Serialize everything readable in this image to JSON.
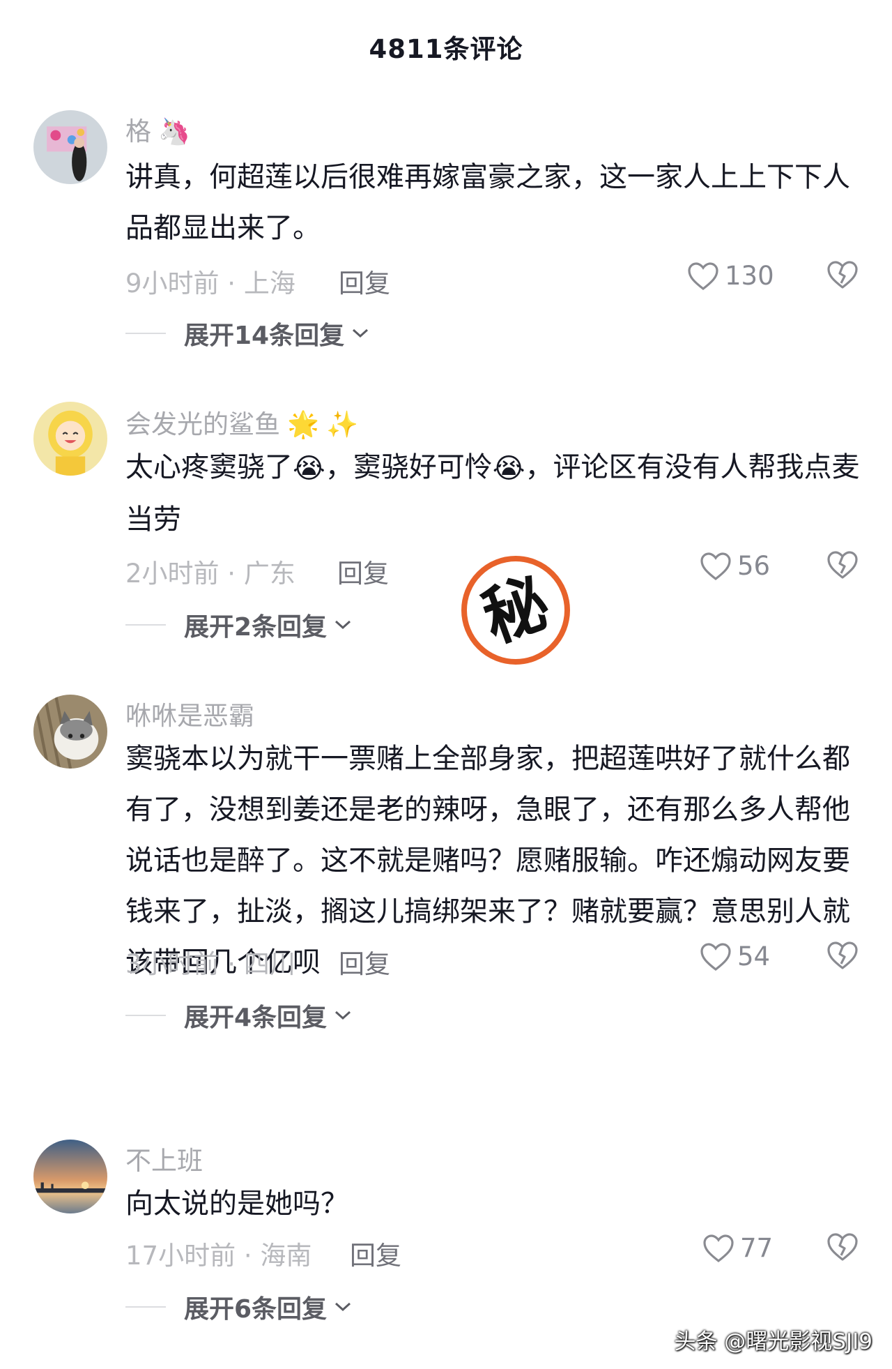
{
  "header": {
    "title": "4811条评论"
  },
  "comments": [
    {
      "username": "格",
      "username_emoji": "unicorn",
      "content": "讲真，何超莲以后很难再嫁富豪之家，这一家人上上下下人品都显出来了。",
      "time_location": "9小时前 · 上海",
      "reply_label": "回复",
      "likes": "130",
      "expand_label": "展开14条回复"
    },
    {
      "username": "会发光的鲨鱼",
      "username_emoji": "glowing-star sparkles",
      "content_parts": [
        "太心疼窦骁了",
        "，窦骁好可怜",
        "，评论区有没有人帮我点麦当劳"
      ],
      "time_location": "2小时前 · 广东",
      "reply_label": "回复",
      "likes": "56",
      "expand_label": "展开2条回复"
    },
    {
      "username": "咻咻是恶霸",
      "content": "窦骁本以为就干一票赌上全部身家，把超莲哄好了就什么都有了，没想到姜还是老的辣呀，急眼了，还有那么多人帮他说话也是醉了。这不就是赌吗？愿赌服输。咋还煽动网友要钱来了，扯淡，搁这儿搞绑架来了？赌就要赢？意思别人就该带回几个亿呗",
      "time_location": "3小时前 · 四川",
      "reply_label": "回复",
      "likes": "54",
      "expand_label": "展开4条回复"
    },
    {
      "username": "不上班",
      "content": "向太说的是她吗？",
      "time_location": "17小时前 · 海南",
      "reply_label": "回复",
      "likes": "77",
      "expand_label": "展开6条回复"
    }
  ],
  "stamp": {
    "text": "秘",
    "color": "#e8622a"
  },
  "watermark": "头条 @曙光影视SJI9",
  "colors": {
    "accent_gray": "#a7a8ad",
    "text": "#161823"
  }
}
